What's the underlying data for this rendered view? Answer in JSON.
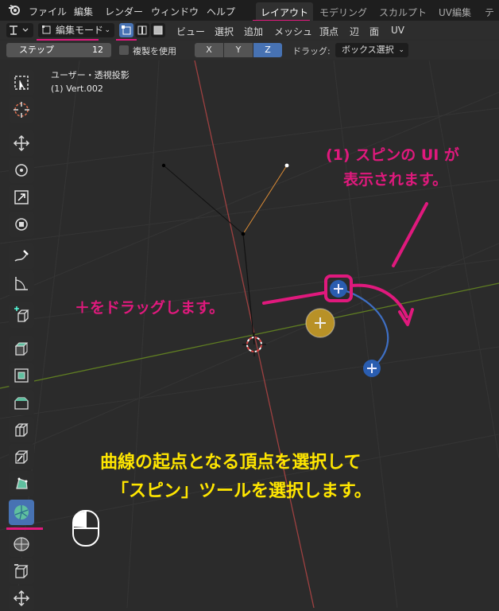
{
  "menubar": {
    "items": [
      "ファイル",
      "編集",
      "レンダー",
      "ウィンドウ",
      "ヘルプ"
    ],
    "workspaces": [
      "レイアウト",
      "モデリング",
      "スカルプト",
      "UV編集",
      "テク"
    ]
  },
  "header": {
    "mode_label": "編集モード",
    "menus": [
      "ビュー",
      "選択",
      "追加",
      "メッシュ",
      "頂点",
      "辺",
      "面",
      "UV"
    ]
  },
  "toolsettings": {
    "step_label": "ステップ",
    "step_value": "12",
    "dup_label": "複製を使用",
    "axes": [
      "X",
      "Y",
      "Z"
    ],
    "active_axis": "Z",
    "drag_label": "ドラッグ:",
    "drag_value": "ボックス選択"
  },
  "viewport": {
    "view_name": "ユーザー・透視投影",
    "object_name": "(1) Vert.002"
  },
  "annotations": {
    "ui_line1": "(1) スピンの UI が",
    "ui_line2": "表示されます。",
    "drag_text": "＋をドラッグします。",
    "bottom_line1": "曲線の起点となる頂点を選択して",
    "bottom_line2": "「スピン」ツールを選択します。"
  },
  "colors": {
    "accent_blue": "#4772b3",
    "annotation_pink": "#e0197d",
    "annotation_yellow": "#ffe600",
    "grid_red": "#b84a4a",
    "grid_green": "#6b8e23"
  }
}
